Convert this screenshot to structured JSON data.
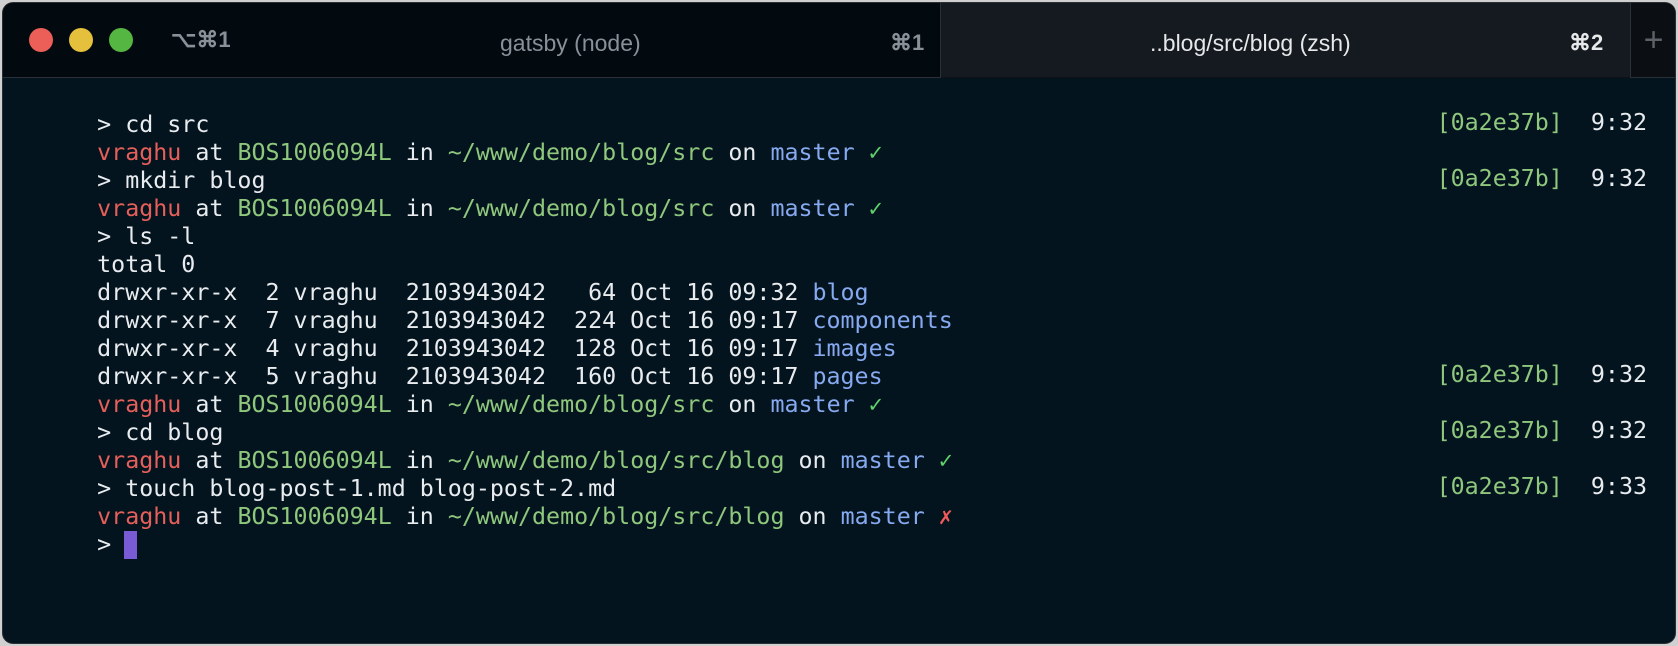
{
  "titlebar": {
    "left_shortcut": "⌥⌘1",
    "tabs": [
      {
        "title": "gatsby (node)",
        "shortcut": "⌘1"
      },
      {
        "title": "..blog/src/blog (zsh)",
        "shortcut": "⌘2"
      }
    ],
    "add_tab_label": "+"
  },
  "terminal": {
    "commands": {
      "c1": "> cd src",
      "c2": "> mkdir blog",
      "c3": "> ls -l",
      "c4": "> cd blog",
      "c5": "> touch blog-post-1.md blog-post-2.md",
      "c6": ">"
    },
    "prompts": [
      {
        "user": "vraghu",
        "at": "at",
        "host": "BOS1006094L",
        "in": "in",
        "path": "~/www/demo/blog/src",
        "on": "on",
        "branch": "master",
        "status": "✓",
        "hash": "[0a2e37b]",
        "time": "9:32"
      },
      {
        "user": "vraghu",
        "at": "at",
        "host": "BOS1006094L",
        "in": "in",
        "path": "~/www/demo/blog/src",
        "on": "on",
        "branch": "master",
        "status": "✓",
        "hash": "[0a2e37b]",
        "time": "9:32"
      },
      {
        "user": "vraghu",
        "at": "at",
        "host": "BOS1006094L",
        "in": "in",
        "path": "~/www/demo/blog/src",
        "on": "on",
        "branch": "master",
        "status": "✓",
        "hash": "[0a2e37b]",
        "time": "9:32"
      },
      {
        "user": "vraghu",
        "at": "at",
        "host": "BOS1006094L",
        "in": "in",
        "path": "~/www/demo/blog/src/blog",
        "on": "on",
        "branch": "master",
        "status": "✓",
        "hash": "[0a2e37b]",
        "time": "9:32"
      },
      {
        "user": "vraghu",
        "at": "at",
        "host": "BOS1006094L",
        "in": "in",
        "path": "~/www/demo/blog/src/blog",
        "on": "on",
        "branch": "master",
        "status": "✗",
        "hash": "[0a2e37b]",
        "time": "9:33"
      }
    ],
    "ls_output": {
      "total": "total 0",
      "entries": [
        {
          "meta": "drwxr-xr-x  2 vraghu  2103943042   64 Oct 16 09:32",
          "name": "blog"
        },
        {
          "meta": "drwxr-xr-x  7 vraghu  2103943042  224 Oct 16 09:17",
          "name": "components"
        },
        {
          "meta": "drwxr-xr-x  4 vraghu  2103943042  128 Oct 16 09:17",
          "name": "images"
        },
        {
          "meta": "drwxr-xr-x  5 vraghu  2103943042  160 Oct 16 09:17",
          "name": "pages"
        }
      ]
    }
  },
  "colors": {
    "background": "#03141f",
    "user": "#e65f5a",
    "host_path": "#8fc77c",
    "branch_dir": "#86a9ef",
    "check": "#5fd36a",
    "cross": "#ef5b59",
    "cursor": "#7a5bd6"
  }
}
